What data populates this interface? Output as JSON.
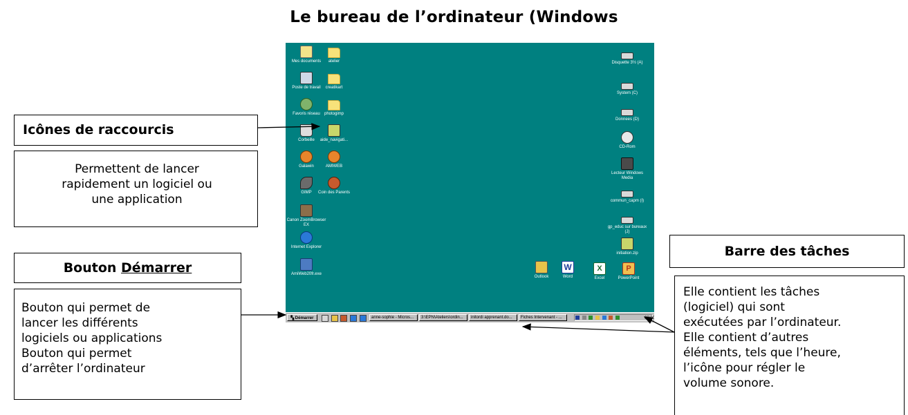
{
  "title": "Le bureau de l’ordinateur (Windows",
  "callouts": {
    "shortcuts": {
      "heading": "Icônes de raccourcis",
      "text": "Permettent de lancer rapidement un logiciel ou une application"
    },
    "start_button": {
      "heading": "Bouton Démarrer",
      "line1": "Bouton qui permet de",
      "line2": "lancer les différents",
      "line3": "logiciels ou applications",
      "line4": "Bouton qui permet",
      "line5": "d’arrêter l’ordinateur"
    },
    "taskbar": {
      "heading": "Barre des tâches",
      "line1": "Elle contient les tâches",
      "line2": "(logiciel) qui sont",
      "line3": "exécutées par l’ordinateur.",
      "line4": "Elle contient d’autres",
      "line5": "éléments, tels que l’heure,",
      "line6": "l’icône pour régler le",
      "line7": "volume sonore."
    }
  },
  "desktop": {
    "left_icons": [
      {
        "label": "Mes documents",
        "icon": "my-documents"
      },
      {
        "label": "atelier",
        "icon": "folder"
      },
      {
        "label": "Poste de travail",
        "icon": "computer"
      },
      {
        "label": "creatikart",
        "icon": "folder"
      },
      {
        "label": "Favoris réseau",
        "icon": "network"
      },
      {
        "label": "photogimp",
        "icon": "folder"
      },
      {
        "label": "Corbeille",
        "icon": "recycle-bin"
      },
      {
        "label": "aide_navigati...",
        "icon": "archive"
      },
      {
        "label": "Galawin",
        "icon": "galawin"
      },
      {
        "label": "AMIWEB",
        "icon": "amiweb"
      },
      {
        "label": "GIMP",
        "icon": "gimp"
      },
      {
        "label": "Coin des Parents",
        "icon": "parents"
      },
      {
        "label": "Canon ZoomBrowser EX",
        "icon": "canon"
      },
      {
        "label": "Internet Explorer",
        "icon": "internet-explorer"
      },
      {
        "label": "AmiWeb20fr.exe",
        "icon": "setup"
      }
    ],
    "right_icons": [
      {
        "label": "Disquette 3½ (A)",
        "icon": "floppy-drive"
      },
      {
        "label": "System (C)",
        "icon": "hard-drive"
      },
      {
        "label": "Donnees (D)",
        "icon": "hard-drive"
      },
      {
        "label": "CD-Rom",
        "icon": "cd-drive"
      },
      {
        "label": "Lecteur Windows Media",
        "icon": "media-player"
      },
      {
        "label": "commun_capm (I)",
        "icon": "network-drive"
      },
      {
        "label": "gp_educ sur bureaux (J)",
        "icon": "network-drive"
      },
      {
        "label": "initiation.zip",
        "icon": "zip"
      }
    ],
    "bottom_icons": [
      {
        "label": "Outlook",
        "icon": "outlook"
      },
      {
        "label": "Word",
        "icon": "word"
      },
      {
        "label": "Excel",
        "icon": "excel"
      },
      {
        "label": "PowerPoint",
        "icon": "powerpoint"
      }
    ],
    "taskbar": {
      "start_label": "Démarrer",
      "tasks": [
        "anne-sophie - Micros...",
        "3:\\EPN\\Ateliers\\ordin...",
        "initordi apprenant.do...",
        "Fiches Intervenant - ..."
      ],
      "clock": "09:00"
    }
  }
}
